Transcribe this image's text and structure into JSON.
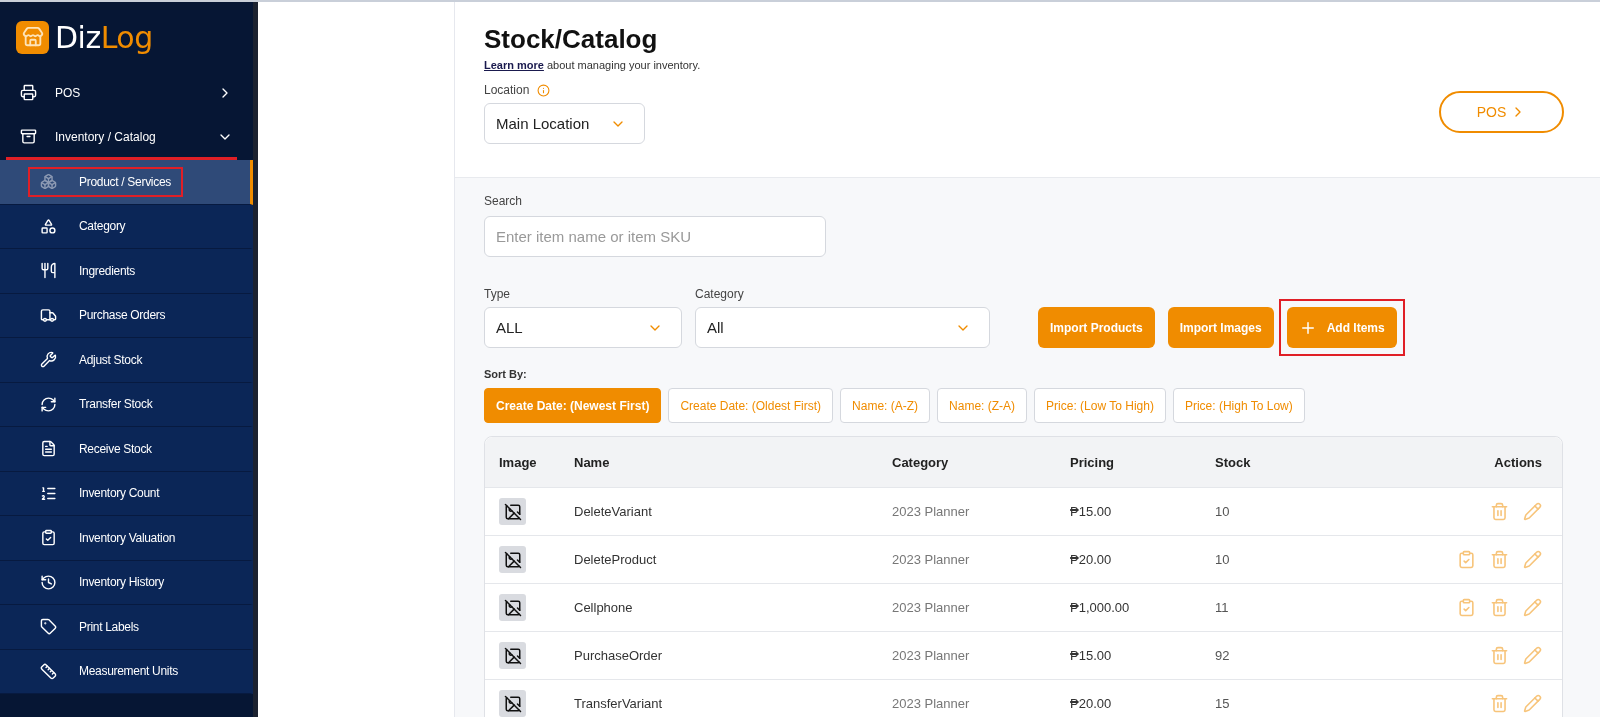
{
  "brand": {
    "first": "Diz",
    "second": "Log"
  },
  "sidebar": {
    "items": [
      {
        "label": "POS",
        "expanded": false,
        "highlighted": false
      },
      {
        "label": "Inventory / Catalog",
        "expanded": true,
        "highlighted": true,
        "children": [
          {
            "label": "Product / Services",
            "selected": true,
            "highlighted": true
          },
          {
            "label": "Category",
            "selected": false,
            "highlighted": false
          },
          {
            "label": "Ingredients",
            "selected": false,
            "highlighted": false
          },
          {
            "label": "Purchase Orders",
            "selected": false,
            "highlighted": false
          },
          {
            "label": "Adjust Stock",
            "selected": false,
            "highlighted": false
          },
          {
            "label": "Transfer Stock",
            "selected": false,
            "highlighted": false
          },
          {
            "label": "Receive Stock",
            "selected": false,
            "highlighted": false
          },
          {
            "label": "Inventory Count",
            "selected": false,
            "highlighted": false
          },
          {
            "label": "Inventory Valuation",
            "selected": false,
            "highlighted": false
          },
          {
            "label": "Inventory History",
            "selected": false,
            "highlighted": false
          },
          {
            "label": "Print Labels",
            "selected": false,
            "highlighted": false
          },
          {
            "label": "Measurement Units",
            "selected": false,
            "highlighted": false
          }
        ]
      }
    ]
  },
  "header": {
    "title": "Stock/Catalog",
    "learn_link": "Learn more",
    "learn_text": " about managing your inventory.",
    "location_label": "Location",
    "location_value": "Main Location",
    "pos_button": "POS"
  },
  "filters": {
    "search_label": "Search",
    "search_placeholder": "Enter item name or item SKU",
    "type_label": "Type",
    "type_value": "ALL",
    "category_label": "Category",
    "category_value": "All"
  },
  "actions": [
    {
      "label": "Import Products",
      "kind": "plain",
      "highlighted": false
    },
    {
      "label": "Import Images",
      "kind": "plain",
      "highlighted": false
    },
    {
      "label": "Add Items",
      "kind": "add",
      "highlighted": true
    }
  ],
  "sort": {
    "label": "Sort By:",
    "options": [
      {
        "label": "Create Date: (Newest First)",
        "selected": true
      },
      {
        "label": "Create Date: (Oldest First)",
        "selected": false
      },
      {
        "label": "Name: (A-Z)",
        "selected": false
      },
      {
        "label": "Name: (Z-A)",
        "selected": false
      },
      {
        "label": "Price: (Low To High)",
        "selected": false
      },
      {
        "label": "Price: (High To Low)",
        "selected": false
      }
    ]
  },
  "table": {
    "columns": [
      "Image",
      "Name",
      "Category",
      "Pricing",
      "Stock",
      "Actions"
    ],
    "rows": [
      {
        "name": "DeleteVariant",
        "category": "2023 Planner",
        "pricing": "₱15.00",
        "stock": "10",
        "valuation": false
      },
      {
        "name": "DeleteProduct",
        "category": "2023 Planner",
        "pricing": "₱20.00",
        "stock": "10",
        "valuation": true
      },
      {
        "name": "Cellphone",
        "category": "2023 Planner",
        "pricing": "₱1,000.00",
        "stock": "11",
        "valuation": true
      },
      {
        "name": "PurchaseOrder",
        "category": "2023 Planner",
        "pricing": "₱15.00",
        "stock": "92",
        "valuation": false
      },
      {
        "name": "TransferVariant",
        "category": "2023 Planner",
        "pricing": "₱20.00",
        "stock": "15",
        "valuation": false
      }
    ]
  }
}
